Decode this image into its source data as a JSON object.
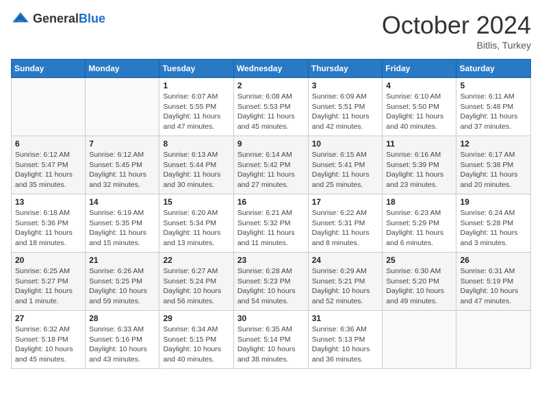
{
  "header": {
    "logo_general": "General",
    "logo_blue": "Blue",
    "month": "October 2024",
    "location": "Bitlis, Turkey"
  },
  "weekdays": [
    "Sunday",
    "Monday",
    "Tuesday",
    "Wednesday",
    "Thursday",
    "Friday",
    "Saturday"
  ],
  "weeks": [
    [
      {
        "day": "",
        "info": ""
      },
      {
        "day": "",
        "info": ""
      },
      {
        "day": "1",
        "info": "Sunrise: 6:07 AM\nSunset: 5:55 PM\nDaylight: 11 hours and 47 minutes."
      },
      {
        "day": "2",
        "info": "Sunrise: 6:08 AM\nSunset: 5:53 PM\nDaylight: 11 hours and 45 minutes."
      },
      {
        "day": "3",
        "info": "Sunrise: 6:09 AM\nSunset: 5:51 PM\nDaylight: 11 hours and 42 minutes."
      },
      {
        "day": "4",
        "info": "Sunrise: 6:10 AM\nSunset: 5:50 PM\nDaylight: 11 hours and 40 minutes."
      },
      {
        "day": "5",
        "info": "Sunrise: 6:11 AM\nSunset: 5:48 PM\nDaylight: 11 hours and 37 minutes."
      }
    ],
    [
      {
        "day": "6",
        "info": "Sunrise: 6:12 AM\nSunset: 5:47 PM\nDaylight: 11 hours and 35 minutes."
      },
      {
        "day": "7",
        "info": "Sunrise: 6:12 AM\nSunset: 5:45 PM\nDaylight: 11 hours and 32 minutes."
      },
      {
        "day": "8",
        "info": "Sunrise: 6:13 AM\nSunset: 5:44 PM\nDaylight: 11 hours and 30 minutes."
      },
      {
        "day": "9",
        "info": "Sunrise: 6:14 AM\nSunset: 5:42 PM\nDaylight: 11 hours and 27 minutes."
      },
      {
        "day": "10",
        "info": "Sunrise: 6:15 AM\nSunset: 5:41 PM\nDaylight: 11 hours and 25 minutes."
      },
      {
        "day": "11",
        "info": "Sunrise: 6:16 AM\nSunset: 5:39 PM\nDaylight: 11 hours and 23 minutes."
      },
      {
        "day": "12",
        "info": "Sunrise: 6:17 AM\nSunset: 5:38 PM\nDaylight: 11 hours and 20 minutes."
      }
    ],
    [
      {
        "day": "13",
        "info": "Sunrise: 6:18 AM\nSunset: 5:36 PM\nDaylight: 11 hours and 18 minutes."
      },
      {
        "day": "14",
        "info": "Sunrise: 6:19 AM\nSunset: 5:35 PM\nDaylight: 11 hours and 15 minutes."
      },
      {
        "day": "15",
        "info": "Sunrise: 6:20 AM\nSunset: 5:34 PM\nDaylight: 11 hours and 13 minutes."
      },
      {
        "day": "16",
        "info": "Sunrise: 6:21 AM\nSunset: 5:32 PM\nDaylight: 11 hours and 11 minutes."
      },
      {
        "day": "17",
        "info": "Sunrise: 6:22 AM\nSunset: 5:31 PM\nDaylight: 11 hours and 8 minutes."
      },
      {
        "day": "18",
        "info": "Sunrise: 6:23 AM\nSunset: 5:29 PM\nDaylight: 11 hours and 6 minutes."
      },
      {
        "day": "19",
        "info": "Sunrise: 6:24 AM\nSunset: 5:28 PM\nDaylight: 11 hours and 3 minutes."
      }
    ],
    [
      {
        "day": "20",
        "info": "Sunrise: 6:25 AM\nSunset: 5:27 PM\nDaylight: 11 hours and 1 minute."
      },
      {
        "day": "21",
        "info": "Sunrise: 6:26 AM\nSunset: 5:25 PM\nDaylight: 10 hours and 59 minutes."
      },
      {
        "day": "22",
        "info": "Sunrise: 6:27 AM\nSunset: 5:24 PM\nDaylight: 10 hours and 56 minutes."
      },
      {
        "day": "23",
        "info": "Sunrise: 6:28 AM\nSunset: 5:23 PM\nDaylight: 10 hours and 54 minutes."
      },
      {
        "day": "24",
        "info": "Sunrise: 6:29 AM\nSunset: 5:21 PM\nDaylight: 10 hours and 52 minutes."
      },
      {
        "day": "25",
        "info": "Sunrise: 6:30 AM\nSunset: 5:20 PM\nDaylight: 10 hours and 49 minutes."
      },
      {
        "day": "26",
        "info": "Sunrise: 6:31 AM\nSunset: 5:19 PM\nDaylight: 10 hours and 47 minutes."
      }
    ],
    [
      {
        "day": "27",
        "info": "Sunrise: 6:32 AM\nSunset: 5:18 PM\nDaylight: 10 hours and 45 minutes."
      },
      {
        "day": "28",
        "info": "Sunrise: 6:33 AM\nSunset: 5:16 PM\nDaylight: 10 hours and 43 minutes."
      },
      {
        "day": "29",
        "info": "Sunrise: 6:34 AM\nSunset: 5:15 PM\nDaylight: 10 hours and 40 minutes."
      },
      {
        "day": "30",
        "info": "Sunrise: 6:35 AM\nSunset: 5:14 PM\nDaylight: 10 hours and 38 minutes."
      },
      {
        "day": "31",
        "info": "Sunrise: 6:36 AM\nSunset: 5:13 PM\nDaylight: 10 hours and 36 minutes."
      },
      {
        "day": "",
        "info": ""
      },
      {
        "day": "",
        "info": ""
      }
    ]
  ]
}
